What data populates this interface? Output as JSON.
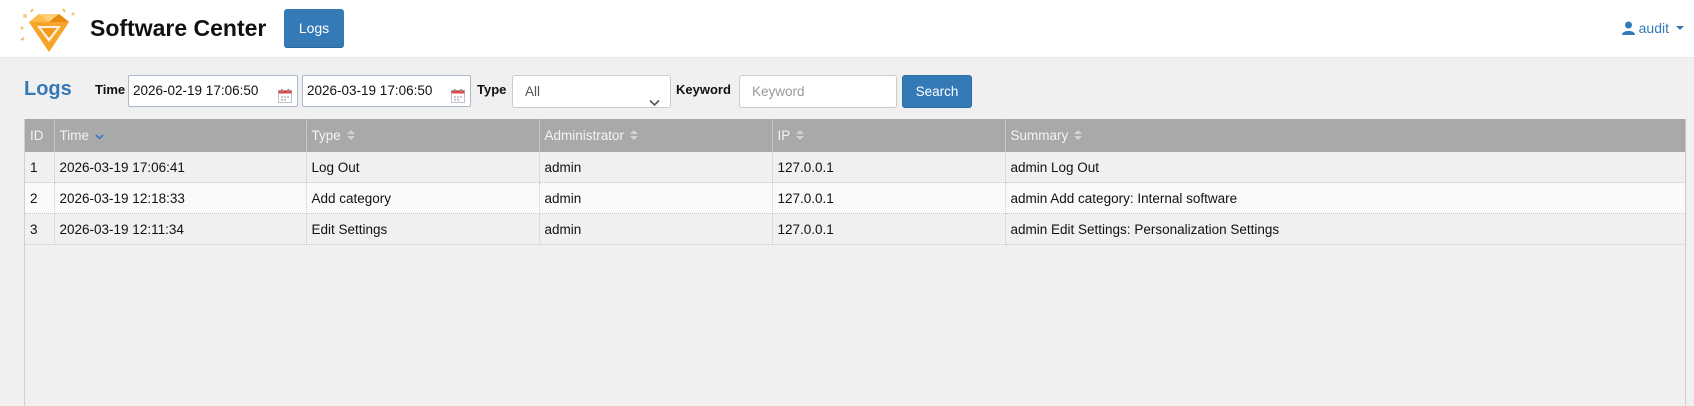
{
  "header": {
    "app_title": "Software Center",
    "nav_logs": "Logs",
    "user": "audit",
    "user_icon": "user-icon",
    "logo_icon": "diamond-logo-icon"
  },
  "filters": {
    "page_title": "Logs",
    "time_label": "Time",
    "time_from": "2026-02-19 17:06:50",
    "time_to": "2026-03-19 17:06:50",
    "type_label": "Type",
    "type_value": "All",
    "keyword_label": "Keyword",
    "keyword_placeholder": "Keyword",
    "search_label": "Search"
  },
  "table": {
    "columns": [
      "ID",
      "Time",
      "Type",
      "Administrator",
      "IP",
      "Summary"
    ],
    "sorted_column": "Time",
    "rows": [
      [
        "1",
        "2026-03-19 17:06:41",
        "Log Out",
        "admin",
        "127.0.0.1",
        "admin Log Out"
      ],
      [
        "2",
        "2026-03-19 12:18:33",
        "Add category",
        "admin",
        "127.0.0.1",
        "admin Add category: Internal software"
      ],
      [
        "3",
        "2026-03-19 12:11:34",
        "Edit Settings",
        "admin",
        "127.0.0.1",
        "admin Edit Settings: Personalization Settings"
      ]
    ]
  },
  "colors": {
    "accent": "#337ab7",
    "header_bg": "#a9a9a9",
    "logo_orange": "#f39a1b"
  }
}
